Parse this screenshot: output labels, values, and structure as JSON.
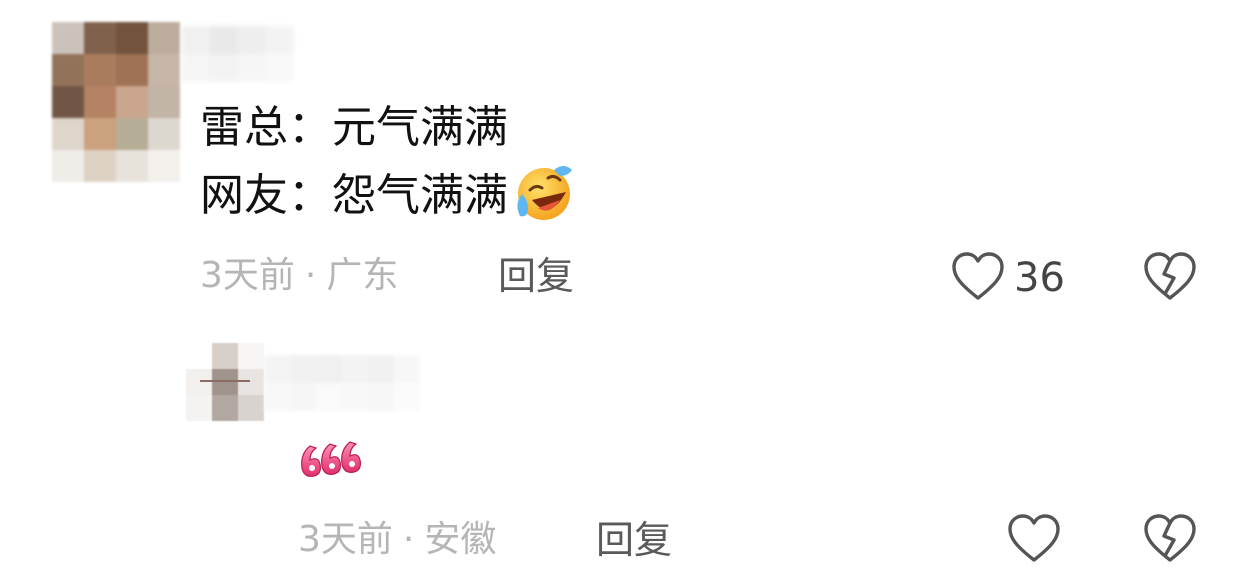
{
  "comments": [
    {
      "lines": [
        "雷总：元气满满",
        "网友：怨气满满"
      ],
      "emoji": "laughing-crying-emoji",
      "time": "3天前",
      "separator": "·",
      "location": "广东",
      "reply_label": "回复",
      "like_count": "36"
    },
    {
      "sticker": "666-sticker",
      "time": "3天前",
      "separator": "·",
      "location": "安徽",
      "reply_label": "回复"
    }
  ],
  "colors": {
    "text": "#111111",
    "meta": "#b5b5b5",
    "reply": "#5a5a5a",
    "icon_stroke": "#555555",
    "sticker_pink": "#e84a7f"
  }
}
